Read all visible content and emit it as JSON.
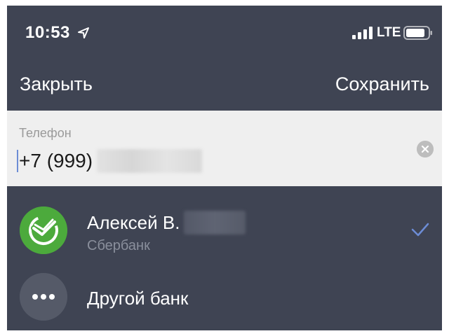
{
  "status_bar": {
    "time": "10:53",
    "network": "LTE",
    "location_icon": "location-arrow-icon",
    "signal_icon": "signal-bars-icon",
    "battery_icon": "battery-icon"
  },
  "nav": {
    "close_label": "Закрыть",
    "save_label": "Сохранить"
  },
  "phone_field": {
    "label": "Телефон",
    "value": "+7 (999)",
    "clear_icon": "clear-circle-icon"
  },
  "banks": [
    {
      "account_name": "Алексей В.",
      "bank_name": "Сбербанк",
      "logo_icon": "sberbank-logo-icon",
      "selected": true,
      "selected_icon": "checkmark-icon"
    },
    {
      "label": "Другой банк",
      "logo_icon": "more-dots-icon",
      "selected": false
    }
  ],
  "colors": {
    "background": "#3f4453",
    "field_background": "#efefef",
    "sber_green": "#4caa3c",
    "accent_blue": "#6c8cd5",
    "secondary_text": "#8a8f9c"
  }
}
